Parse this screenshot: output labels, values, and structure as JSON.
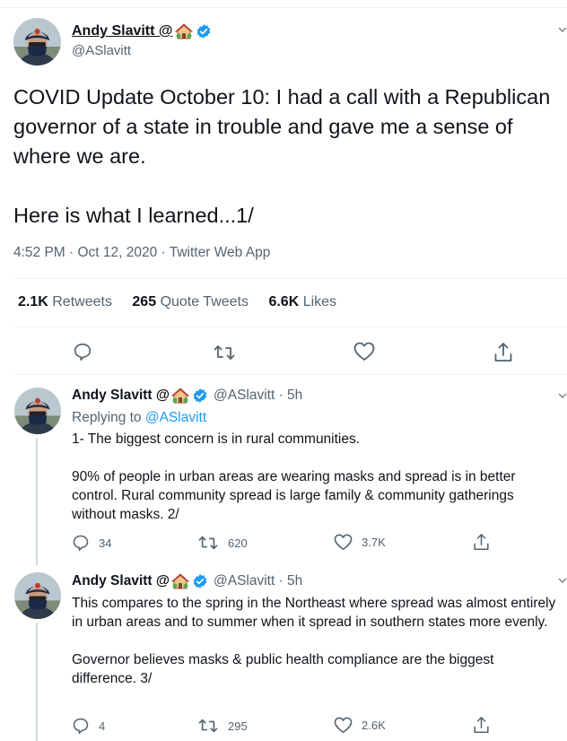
{
  "main_tweet": {
    "author_name": "Andy Slavitt @",
    "author_handle": "@ASlavitt",
    "text": "COVID Update October 10: I had a call with a Republican governor of a state in trouble and gave me a sense of where we are.\n\nHere is what I learned...1/",
    "meta": "4:52 PM · Oct 12, 2020 · Twitter Web App",
    "stats": {
      "retweets_count": "2.1K",
      "retweets_label": "Retweets",
      "quotes_count": "265",
      "quotes_label": "Quote Tweets",
      "likes_count": "6.6K",
      "likes_label": "Likes"
    }
  },
  "replies": [
    {
      "author_name": "Andy Slavitt @",
      "author_handle": "@ASlavitt · 5h",
      "replying_prefix": "Replying to",
      "replying_to": "@ASlavitt",
      "text": "1- The biggest concern is in rural communities.\n\n90% of people in urban areas are wearing masks and spread is in better control. Rural community spread is large family & community gatherings without masks. 2/",
      "reply_count": "34",
      "retweet_count": "620",
      "like_count": "3.7K"
    },
    {
      "author_name": "Andy Slavitt @",
      "author_handle": "@ASlavitt · 5h",
      "text": "This compares to the spring in the Northeast where spread was almost entirely in urban areas and to summer when it spread in southern states more evenly.\n\nGovernor believes masks & public health compliance are the biggest difference. 3/",
      "reply_count": "4",
      "retweet_count": "295",
      "like_count": "2.6K"
    }
  ],
  "icons": {
    "house": "house-with-garden-emoji",
    "verified": "verified-badge-icon",
    "reply": "reply-icon",
    "retweet": "retweet-icon",
    "like": "heart-icon",
    "share": "share-icon",
    "more": "chevron-down-icon"
  },
  "colors": {
    "link": "#1d9bf0",
    "secondary_text": "#536471",
    "verified": "#1d9bf0"
  }
}
